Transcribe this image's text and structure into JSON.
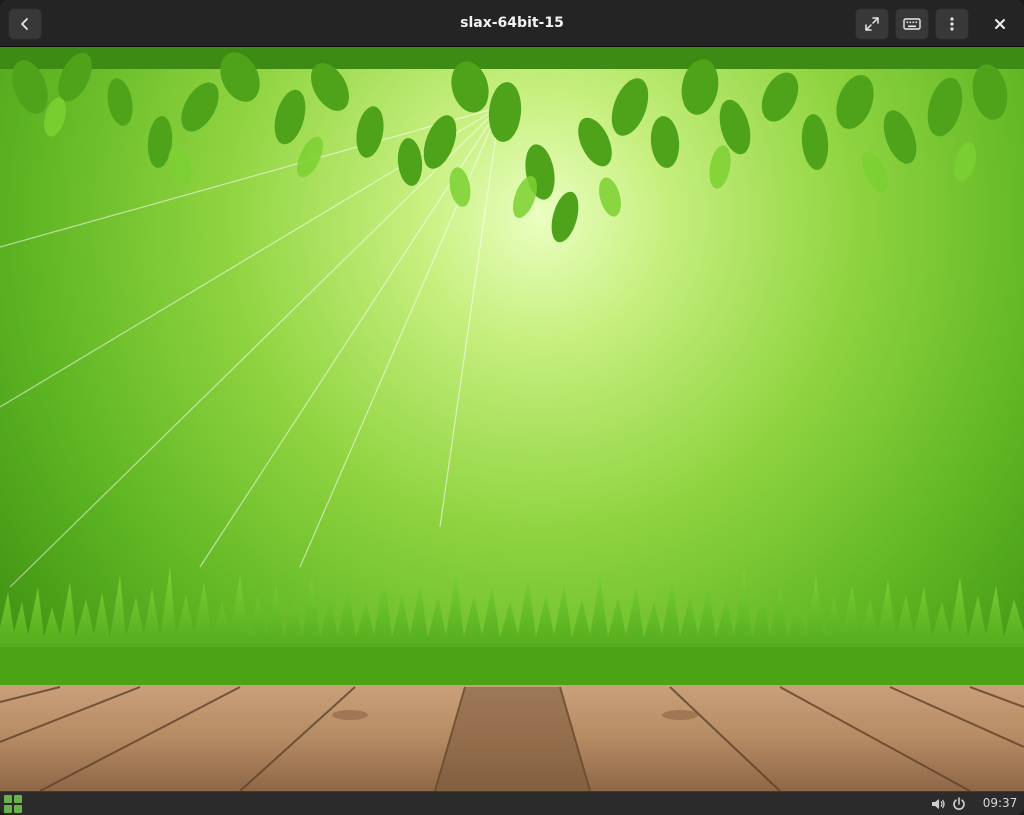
{
  "window": {
    "title": "slax-64bit-15"
  },
  "headerbar": {
    "buttons": [
      {
        "name": "back",
        "icon": "chevron-left-icon"
      },
      {
        "name": "fullscreen",
        "icon": "expand-icon"
      },
      {
        "name": "keyboard",
        "icon": "keyboard-icon"
      },
      {
        "name": "menu",
        "icon": "vertical-dots-icon"
      },
      {
        "name": "close",
        "icon": "close-icon"
      }
    ]
  },
  "taskbar": {
    "start_icon": "app-grid-icon",
    "tray_icons": [
      "volume-icon",
      "power-icon"
    ],
    "clock": "09:37"
  },
  "colors": {
    "headerbar": "#242424",
    "taskbar": "#2b2b2b",
    "accent_green": "#6ab04c",
    "wallpaper_light": "#d8f59a",
    "wallpaper_dark": "#4fa81c",
    "wood": "#b58b63"
  }
}
